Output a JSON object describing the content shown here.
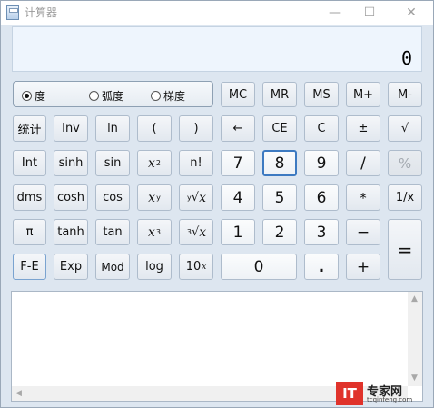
{
  "window": {
    "title": "计算器",
    "minimize_icon": "—",
    "maximize_icon": "☐",
    "close_icon": "✕"
  },
  "display": {
    "value": "0"
  },
  "angle_units": [
    {
      "label": "度",
      "selected": true
    },
    {
      "label": "弧度",
      "selected": false
    },
    {
      "label": "梯度",
      "selected": false
    }
  ],
  "memory": {
    "mc": "MC",
    "mr": "MR",
    "ms": "MS",
    "mplus": "M+",
    "mminus": "M-"
  },
  "sci": {
    "stats": "统计",
    "inv": "Inv",
    "ln": "ln",
    "lparen": "(",
    "rparen": ")",
    "int": "Int",
    "sinh": "sinh",
    "sin": "sin",
    "x2_base": "x",
    "x2_exp": "2",
    "nfact": "n!",
    "dms": "dms",
    "cosh": "cosh",
    "cos": "cos",
    "xy_base": "x",
    "xy_exp": "y",
    "yroot_idx": "y",
    "yroot_sym": "√",
    "yroot_x": "x",
    "pi": "π",
    "tanh": "tanh",
    "tan": "tan",
    "x3_base": "x",
    "x3_exp": "3",
    "croot_idx": "3",
    "croot_sym": "√",
    "croot_x": "x",
    "fe": "F-E",
    "exp": "Exp",
    "mod": "Mod",
    "log": "log",
    "ten_base": "10",
    "ten_exp": "x"
  },
  "ops": {
    "backspace": "←",
    "ce": "CE",
    "c": "C",
    "plusminus": "±",
    "sqrt": "√",
    "divide": "/",
    "percent": "%",
    "multiply": "*",
    "reciprocal": "1/x",
    "minus": "−",
    "plus": "+",
    "equals": "=",
    "decimal": "."
  },
  "digits": {
    "d0": "0",
    "d1": "1",
    "d2": "2",
    "d3": "3",
    "d4": "4",
    "d5": "5",
    "d6": "6",
    "d7": "7",
    "d8": "8",
    "d9": "9"
  },
  "history": {
    "scroll_up": "▲",
    "scroll_down": "▼",
    "scroll_left": "◀",
    "scroll_right": "▶"
  },
  "watermark": {
    "logo": "IT",
    "name": "专家网",
    "url": "tcqinfeng.com"
  }
}
